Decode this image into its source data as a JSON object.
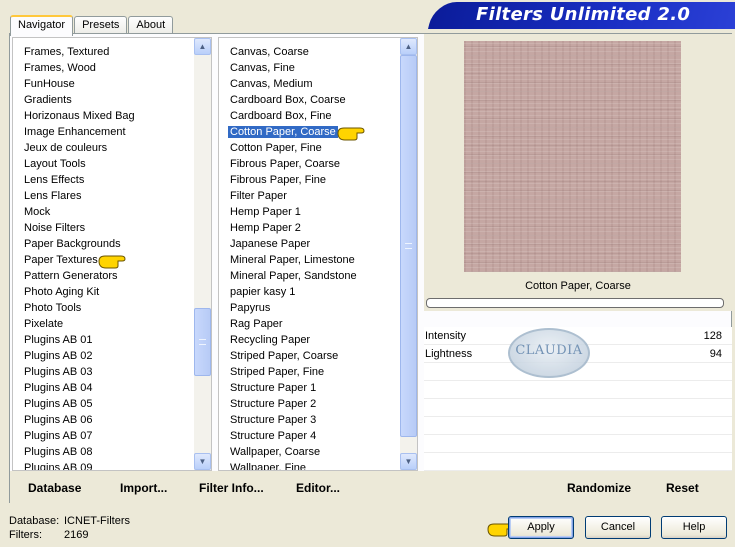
{
  "tabs": [
    "Navigator",
    "Presets",
    "About"
  ],
  "app_title": "Filters Unlimited 2.0",
  "categories": [
    "Frames, Textured",
    "Frames, Wood",
    "FunHouse",
    "Gradients",
    "Horizonaus Mixed Bag",
    "Image Enhancement",
    "Jeux de couleurs",
    "Layout Tools",
    "Lens Effects",
    "Lens Flares",
    "Mock",
    "Noise Filters",
    "Paper Backgrounds",
    "Paper Textures",
    "Pattern Generators",
    "Photo Aging Kit",
    "Photo Tools",
    "Pixelate",
    "Plugins AB 01",
    "Plugins AB 02",
    "Plugins AB 03",
    "Plugins AB 04",
    "Plugins AB 05",
    "Plugins AB 06",
    "Plugins AB 07",
    "Plugins AB 08",
    "Plugins AB 09"
  ],
  "filters": [
    "Canvas, Coarse",
    "Canvas, Fine",
    "Canvas, Medium",
    "Cardboard Box, Coarse",
    "Cardboard Box, Fine",
    "Cotton Paper, Coarse",
    "Cotton Paper, Fine",
    "Fibrous Paper, Coarse",
    "Fibrous Paper, Fine",
    "Filter Paper",
    "Hemp Paper 1",
    "Hemp Paper 2",
    "Japanese Paper",
    "Mineral Paper, Limestone",
    "Mineral Paper, Sandstone",
    "papier kasy 1",
    "Papyrus",
    "Rag Paper",
    "Recycling Paper",
    "Striped Paper, Coarse",
    "Striped Paper, Fine",
    "Structure Paper 1",
    "Structure Paper 2",
    "Structure Paper 3",
    "Structure Paper 4",
    "Wallpaper, Coarse",
    "Wallpaper, Fine"
  ],
  "selected_filter_index": 5,
  "preview": {
    "filter_name": "Cotton Paper, Coarse"
  },
  "params": [
    {
      "label": "Intensity",
      "value": "128"
    },
    {
      "label": "Lightness",
      "value": "94"
    }
  ],
  "watermark_text": "CLAUDIA",
  "panel_buttons": {
    "database": "Database",
    "import": "Import...",
    "filter_info": "Filter Info...",
    "editor": "Editor...",
    "randomize": "Randomize",
    "reset": "Reset"
  },
  "status": {
    "database_label": "Database:",
    "database_value": "ICNET-Filters",
    "filters_label": "Filters:",
    "filters_value": "2169"
  },
  "dialog_buttons": {
    "apply": "Apply",
    "cancel": "Cancel",
    "help": "Help"
  },
  "colors": {
    "selection": "#316ac5",
    "banner": "#0b1c9a",
    "pointer": "#ffd400"
  }
}
